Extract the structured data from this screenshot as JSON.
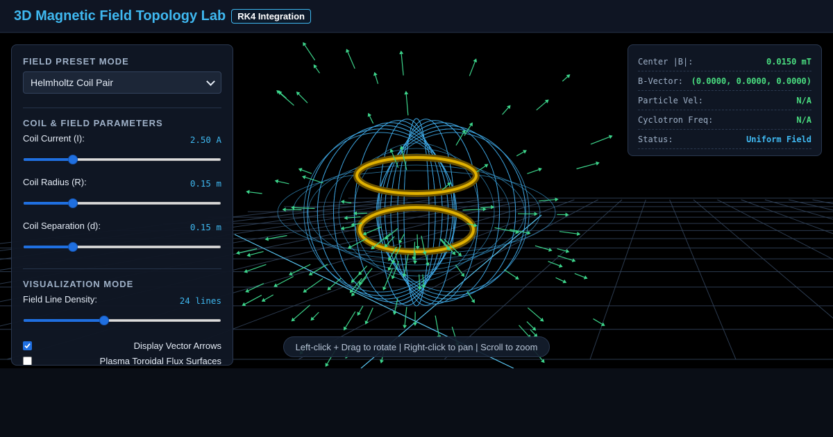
{
  "header": {
    "title": "3D Magnetic Field Topology Lab",
    "badge": "RK4 Integration"
  },
  "controls": {
    "preset_title": "Field Preset Mode",
    "preset_value": "Helmholtz Coil Pair",
    "params_title": "Coil & Field Parameters",
    "current": {
      "label": "Coil Current (I):",
      "value": "2.50 A",
      "level": 0.25
    },
    "radius": {
      "label": "Coil Radius (R):",
      "value": "0.15 m",
      "level": 0.25
    },
    "separation": {
      "label": "Coil Separation (d):",
      "value": "0.15 m",
      "level": 0.25
    },
    "viz_title": "Visualization Mode",
    "density": {
      "label": "Field Line Density:",
      "value": "24 lines",
      "level": 0.41
    },
    "vector_arrows": {
      "label": "Display Vector Arrows",
      "checked": true
    },
    "flux_surfaces": {
      "label": "Plasma Toroidal Flux Surfaces",
      "checked": false
    }
  },
  "readout": {
    "center_b": {
      "label": "Center |B|:",
      "value": "0.0150 mT"
    },
    "b_vector": {
      "label": "B-Vector:",
      "value": "(0.0000, 0.0000, 0.0000)"
    },
    "particle_vel": {
      "label": "Particle Vel:",
      "value": "N/A"
    },
    "cyclotron": {
      "label": "Cyclotron Freq:",
      "value": "N/A"
    },
    "status": {
      "label": "Status:",
      "value": "Uniform Field"
    }
  },
  "hint": "Left-click + Drag to rotate | Right-click to pan | Scroll to zoom",
  "colors": {
    "accent": "#3fb8f0",
    "field_lines": "#3fa9e6",
    "vectors": "#3dd68c",
    "coil": "#e0b100",
    "status_green": "#4ade80"
  }
}
